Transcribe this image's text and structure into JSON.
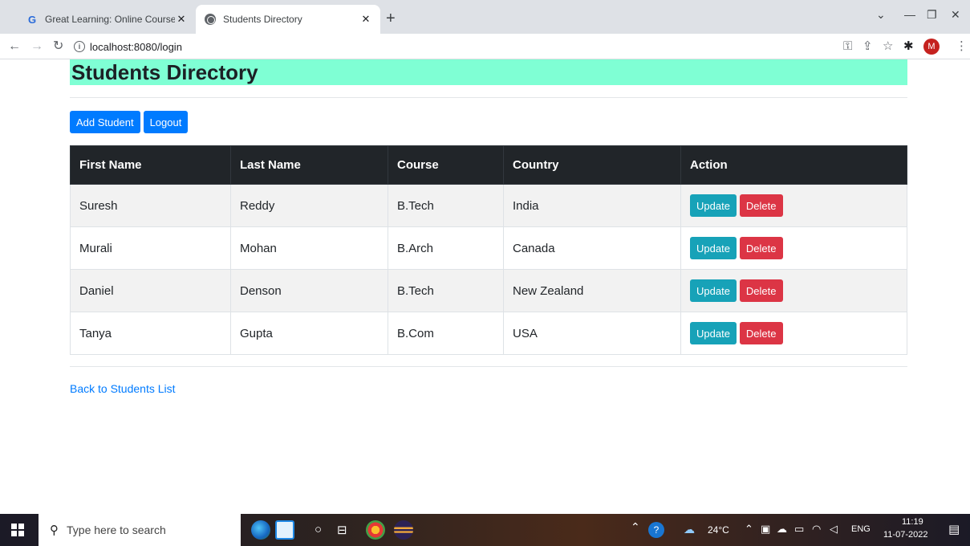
{
  "browser": {
    "tabs": [
      {
        "title": "Great Learning: Online Courses, F",
        "favicon": "G",
        "active": false
      },
      {
        "title": "Students Directory",
        "active": true
      }
    ],
    "url": "localhost:8080/login",
    "profile_initial": "M"
  },
  "page": {
    "title": "Students Directory",
    "buttons": {
      "add_student": "Add Student",
      "logout": "Logout"
    },
    "table": {
      "headers": [
        "First Name",
        "Last Name",
        "Course",
        "Country",
        "Action"
      ],
      "rows": [
        {
          "first": "Suresh",
          "last": "Reddy",
          "course": "B.Tech",
          "country": "India"
        },
        {
          "first": "Murali",
          "last": "Mohan",
          "course": "B.Arch",
          "country": "Canada"
        },
        {
          "first": "Daniel",
          "last": "Denson",
          "course": "B.Tech",
          "country": "New Zealand"
        },
        {
          "first": "Tanya",
          "last": "Gupta",
          "course": "B.Com",
          "country": "USA"
        }
      ],
      "update_label": "Update",
      "delete_label": "Delete"
    },
    "back_link": "Back to Students List",
    "colors": {
      "header_bg": "#7fffd4",
      "primary": "#007bff",
      "info": "#17a2b8",
      "danger": "#dc3545",
      "table_head": "#212529"
    }
  },
  "taskbar": {
    "search_placeholder": "Type here to search",
    "weather": "24°C",
    "language": "ENG",
    "time": "11:19",
    "date": "11-07-2022"
  }
}
